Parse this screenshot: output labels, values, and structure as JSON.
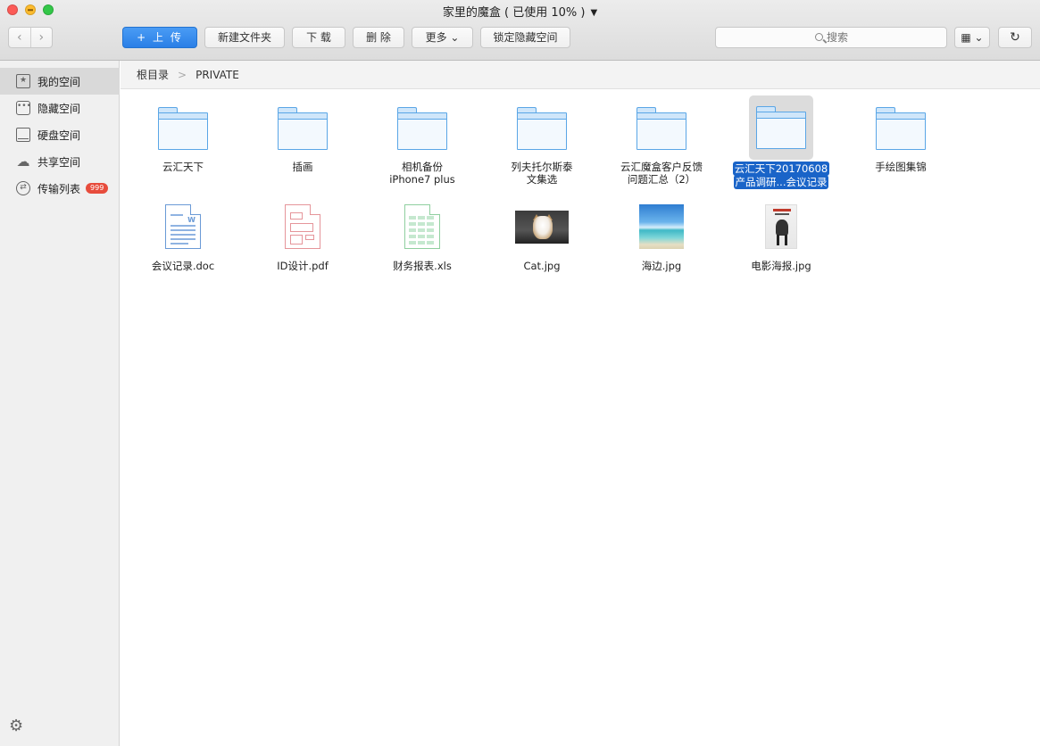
{
  "window": {
    "title": "家里的魔盒 ( 已使用 10% )"
  },
  "toolbar": {
    "back": "‹",
    "forward": "›",
    "upload": "+ 上 传",
    "new_folder": "新建文件夹",
    "download": "下 载",
    "delete": "删 除",
    "more": "更多 ⌄",
    "lock_hidden": "锁定隐藏空间",
    "search_placeholder": "搜索",
    "view_mode": "▦ ⌄",
    "refresh": "↻"
  },
  "sidebar": {
    "items": [
      {
        "label": "我的空间",
        "icon": "star-bookmark-icon",
        "active": true
      },
      {
        "label": "隐藏空间",
        "icon": "dots-icon"
      },
      {
        "label": "硬盘空间",
        "icon": "disk-icon"
      },
      {
        "label": "共享空间",
        "icon": "cloud-icon"
      },
      {
        "label": "传输列表",
        "icon": "transfer-icon",
        "badge": "999"
      }
    ],
    "settings_icon": "gear-icon"
  },
  "breadcrumb": {
    "root": "根目录",
    "separator": ">",
    "current": "PRIVATE"
  },
  "files": [
    {
      "name": "云汇天下",
      "type": "folder"
    },
    {
      "name": "插画",
      "type": "folder"
    },
    {
      "name": "相机备份\niPhone7 plus",
      "type": "folder"
    },
    {
      "name": "列夫托尔斯泰\n文集选",
      "type": "folder"
    },
    {
      "name": "云汇魔盒客户反馈\n问题汇总（2）",
      "type": "folder"
    },
    {
      "name": "云汇天下20170608\n产品调研...会议记录",
      "type": "folder",
      "selected": true
    },
    {
      "name": "手绘图集锦",
      "type": "folder"
    },
    {
      "name": "会议记录.doc",
      "type": "doc"
    },
    {
      "name": "ID设计.pdf",
      "type": "pdf"
    },
    {
      "name": "财务报表.xls",
      "type": "xls"
    },
    {
      "name": "Cat.jpg",
      "type": "image-cat"
    },
    {
      "name": "海边.jpg",
      "type": "image-beach"
    },
    {
      "name": "电影海报.jpg",
      "type": "image-poster"
    }
  ],
  "colors": {
    "accent": "#2a7fe6",
    "selection": "#1a64c8",
    "badge": "#e74c3c",
    "folder": "#5aa6e6"
  }
}
